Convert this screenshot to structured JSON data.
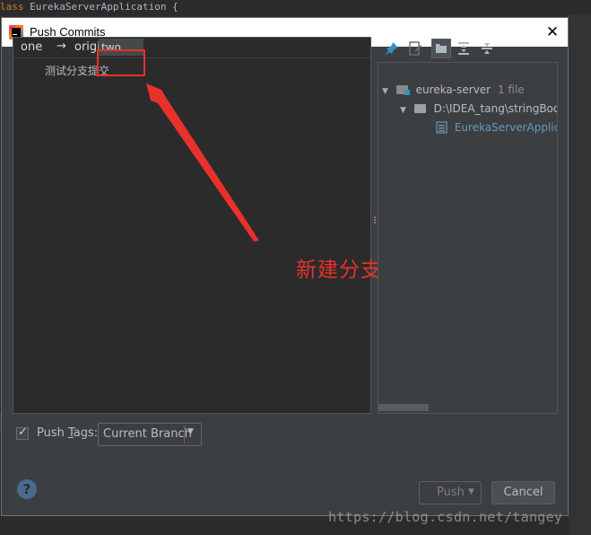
{
  "editor": {
    "code_keyword": "lass",
    "code_rest": " EurekaServerApplication {"
  },
  "dialog": {
    "title": "Push Commits",
    "close_glyph": "✕"
  },
  "commits": {
    "source_branch": "one",
    "arrow": "→",
    "remote": "origin",
    "target_branch_value": "two",
    "commit_message": "测试分支提交"
  },
  "annotation": {
    "text": "新建分支名字",
    "color": "#e8312b"
  },
  "files": {
    "module_name": "eureka-server",
    "module_count": "1 file",
    "folder_path": "D:\\IDEA_tang\\stringBoo",
    "file_name": "EurekaServerApplica"
  },
  "toolbar_icons": [
    "pin-icon",
    "edit-source-icon",
    "group-by-directory-icon",
    "expand-all-icon",
    "collapse-all-icon"
  ],
  "bottom": {
    "push_tags_label": "Push Tags:",
    "push_tags_checked": true,
    "tags_mode_selected": "Current Branch",
    "push_label": "Push",
    "cancel_label": "Cancel",
    "help_glyph": "?"
  },
  "watermark": "https://blog.csdn.net/tangey"
}
